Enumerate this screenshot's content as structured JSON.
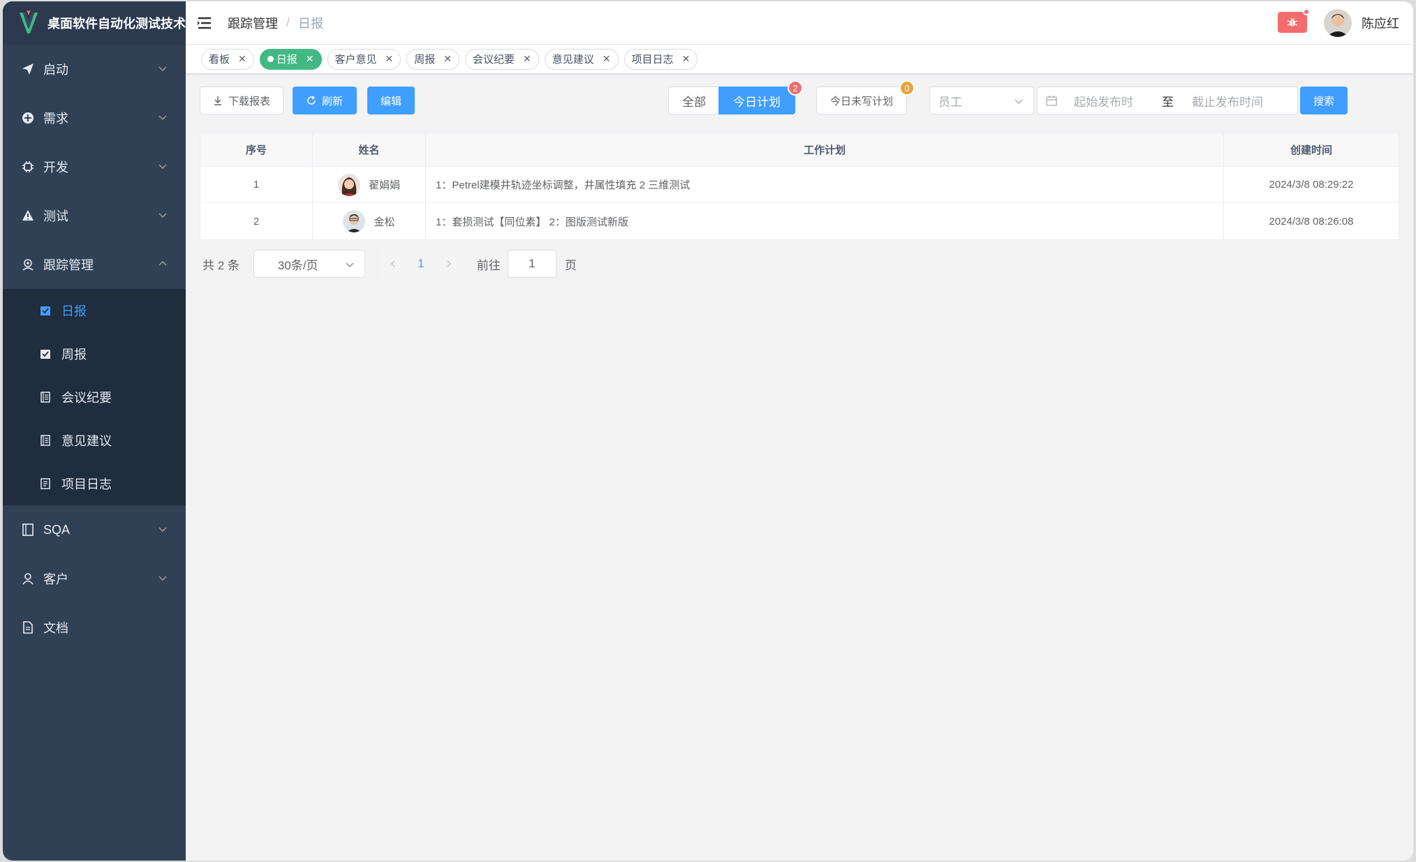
{
  "app": {
    "title": "桌面软件自动化测试技术"
  },
  "sidebar": {
    "items": [
      {
        "label": "启动",
        "icon": "send-icon"
      },
      {
        "label": "需求",
        "icon": "plus-circle-icon"
      },
      {
        "label": "开发",
        "icon": "chip-icon"
      },
      {
        "label": "测试",
        "icon": "warning-icon"
      },
      {
        "label": "跟踪管理",
        "icon": "location-user-icon"
      },
      {
        "label": "SQA",
        "icon": "book-icon"
      },
      {
        "label": "客户",
        "icon": "user-icon"
      },
      {
        "label": "文档",
        "icon": "document-icon"
      }
    ],
    "sub_items": [
      {
        "label": "日报",
        "icon": "clipboard-check-icon"
      },
      {
        "label": "周报",
        "icon": "clipboard-check-icon"
      },
      {
        "label": "会议纪要",
        "icon": "notebook-icon"
      },
      {
        "label": "意见建议",
        "icon": "notebook-icon"
      },
      {
        "label": "项目日志",
        "icon": "log-icon"
      }
    ]
  },
  "header": {
    "breadcrumb": [
      "跟踪管理",
      "日报"
    ],
    "user_name": "陈应红"
  },
  "tags": [
    "看板",
    "日报",
    "客户意见",
    "周报",
    "会议纪要",
    "意见建议",
    "项目日志"
  ],
  "toolbar": {
    "download_label": "下载报表",
    "refresh_label": "刷新",
    "edit_label": "编辑",
    "all_label": "全部",
    "today_plan_label": "今日计划",
    "today_plan_count": "2",
    "unwritten_label": "今日未写计划",
    "unwritten_count": "0",
    "employee_placeholder": "员工",
    "start_placeholder": "起始发布时",
    "range_sep": "至",
    "end_placeholder": "截止发布时间",
    "search_label": "搜索"
  },
  "table": {
    "columns": [
      "序号",
      "姓名",
      "工作计划",
      "创建时间"
    ],
    "rows": [
      {
        "index": "1",
        "name": "翟娟娟",
        "plan": "1：Petrel建模井轨迹坐标调整，井属性填充 2 三维测试",
        "time": "2024/3/8 08:29:22"
      },
      {
        "index": "2",
        "name": "金松",
        "plan": "1：套损测试【同位素】 2：图版测试新版",
        "time": "2024/3/8 08:26:08"
      }
    ]
  },
  "pagination": {
    "total": "共 2 条",
    "page_size": "30条/页",
    "current": "1",
    "goto_label": "前往",
    "goto_value": "1",
    "page_suffix": "页"
  },
  "colors": {
    "sidebar": "#304156",
    "primary": "#409eff",
    "active_tag": "#42b983",
    "danger": "#f56c6c",
    "warning": "#e6a23c"
  }
}
